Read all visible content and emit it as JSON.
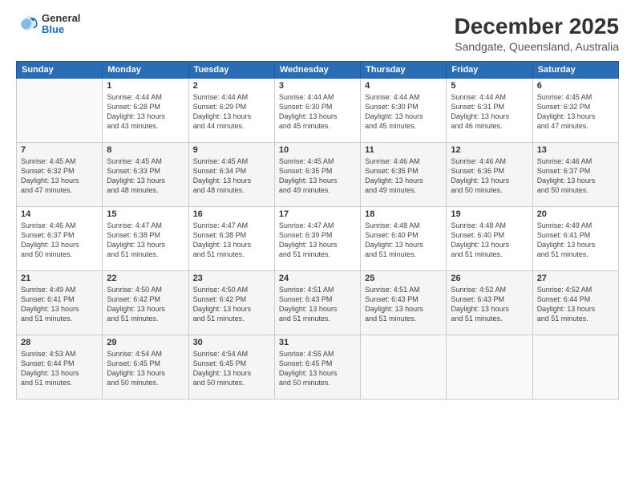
{
  "logo": {
    "general": "General",
    "blue": "Blue"
  },
  "header": {
    "title": "December 2025",
    "subtitle": "Sandgate, Queensland, Australia"
  },
  "weekdays": [
    "Sunday",
    "Monday",
    "Tuesday",
    "Wednesday",
    "Thursday",
    "Friday",
    "Saturday"
  ],
  "weeks": [
    [
      {
        "day": "",
        "info": ""
      },
      {
        "day": "1",
        "info": "Sunrise: 4:44 AM\nSunset: 6:28 PM\nDaylight: 13 hours\nand 43 minutes."
      },
      {
        "day": "2",
        "info": "Sunrise: 4:44 AM\nSunset: 6:29 PM\nDaylight: 13 hours\nand 44 minutes."
      },
      {
        "day": "3",
        "info": "Sunrise: 4:44 AM\nSunset: 6:30 PM\nDaylight: 13 hours\nand 45 minutes."
      },
      {
        "day": "4",
        "info": "Sunrise: 4:44 AM\nSunset: 6:30 PM\nDaylight: 13 hours\nand 45 minutes."
      },
      {
        "day": "5",
        "info": "Sunrise: 4:44 AM\nSunset: 6:31 PM\nDaylight: 13 hours\nand 46 minutes."
      },
      {
        "day": "6",
        "info": "Sunrise: 4:45 AM\nSunset: 6:32 PM\nDaylight: 13 hours\nand 47 minutes."
      }
    ],
    [
      {
        "day": "7",
        "info": "Sunrise: 4:45 AM\nSunset: 6:32 PM\nDaylight: 13 hours\nand 47 minutes."
      },
      {
        "day": "8",
        "info": "Sunrise: 4:45 AM\nSunset: 6:33 PM\nDaylight: 13 hours\nand 48 minutes."
      },
      {
        "day": "9",
        "info": "Sunrise: 4:45 AM\nSunset: 6:34 PM\nDaylight: 13 hours\nand 48 minutes."
      },
      {
        "day": "10",
        "info": "Sunrise: 4:45 AM\nSunset: 6:35 PM\nDaylight: 13 hours\nand 49 minutes."
      },
      {
        "day": "11",
        "info": "Sunrise: 4:46 AM\nSunset: 6:35 PM\nDaylight: 13 hours\nand 49 minutes."
      },
      {
        "day": "12",
        "info": "Sunrise: 4:46 AM\nSunset: 6:36 PM\nDaylight: 13 hours\nand 50 minutes."
      },
      {
        "day": "13",
        "info": "Sunrise: 4:46 AM\nSunset: 6:37 PM\nDaylight: 13 hours\nand 50 minutes."
      }
    ],
    [
      {
        "day": "14",
        "info": "Sunrise: 4:46 AM\nSunset: 6:37 PM\nDaylight: 13 hours\nand 50 minutes."
      },
      {
        "day": "15",
        "info": "Sunrise: 4:47 AM\nSunset: 6:38 PM\nDaylight: 13 hours\nand 51 minutes."
      },
      {
        "day": "16",
        "info": "Sunrise: 4:47 AM\nSunset: 6:38 PM\nDaylight: 13 hours\nand 51 minutes."
      },
      {
        "day": "17",
        "info": "Sunrise: 4:47 AM\nSunset: 6:39 PM\nDaylight: 13 hours\nand 51 minutes."
      },
      {
        "day": "18",
        "info": "Sunrise: 4:48 AM\nSunset: 6:40 PM\nDaylight: 13 hours\nand 51 minutes."
      },
      {
        "day": "19",
        "info": "Sunrise: 4:48 AM\nSunset: 6:40 PM\nDaylight: 13 hours\nand 51 minutes."
      },
      {
        "day": "20",
        "info": "Sunrise: 4:49 AM\nSunset: 6:41 PM\nDaylight: 13 hours\nand 51 minutes."
      }
    ],
    [
      {
        "day": "21",
        "info": "Sunrise: 4:49 AM\nSunset: 6:41 PM\nDaylight: 13 hours\nand 51 minutes."
      },
      {
        "day": "22",
        "info": "Sunrise: 4:50 AM\nSunset: 6:42 PM\nDaylight: 13 hours\nand 51 minutes."
      },
      {
        "day": "23",
        "info": "Sunrise: 4:50 AM\nSunset: 6:42 PM\nDaylight: 13 hours\nand 51 minutes."
      },
      {
        "day": "24",
        "info": "Sunrise: 4:51 AM\nSunset: 6:43 PM\nDaylight: 13 hours\nand 51 minutes."
      },
      {
        "day": "25",
        "info": "Sunrise: 4:51 AM\nSunset: 6:43 PM\nDaylight: 13 hours\nand 51 minutes."
      },
      {
        "day": "26",
        "info": "Sunrise: 4:52 AM\nSunset: 6:43 PM\nDaylight: 13 hours\nand 51 minutes."
      },
      {
        "day": "27",
        "info": "Sunrise: 4:52 AM\nSunset: 6:44 PM\nDaylight: 13 hours\nand 51 minutes."
      }
    ],
    [
      {
        "day": "28",
        "info": "Sunrise: 4:53 AM\nSunset: 6:44 PM\nDaylight: 13 hours\nand 51 minutes."
      },
      {
        "day": "29",
        "info": "Sunrise: 4:54 AM\nSunset: 6:45 PM\nDaylight: 13 hours\nand 50 minutes."
      },
      {
        "day": "30",
        "info": "Sunrise: 4:54 AM\nSunset: 6:45 PM\nDaylight: 13 hours\nand 50 minutes."
      },
      {
        "day": "31",
        "info": "Sunrise: 4:55 AM\nSunset: 6:45 PM\nDaylight: 13 hours\nand 50 minutes."
      },
      {
        "day": "",
        "info": ""
      },
      {
        "day": "",
        "info": ""
      },
      {
        "day": "",
        "info": ""
      }
    ]
  ]
}
